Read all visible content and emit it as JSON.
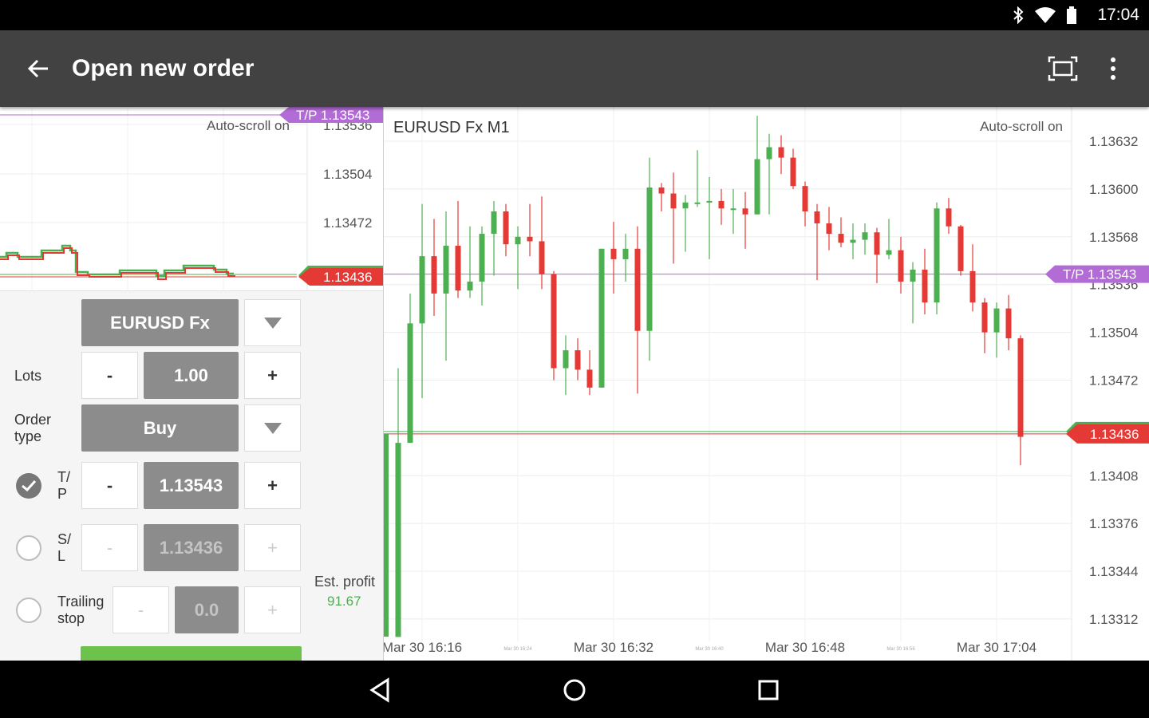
{
  "status": {
    "time": "17:04",
    "icons": [
      "bluetooth-icon",
      "wifi-icon",
      "battery-icon"
    ]
  },
  "appbar": {
    "title": "Open new order",
    "icons": [
      "back-arrow-icon",
      "fullscreen-icon",
      "more-vert-icon"
    ]
  },
  "mini_chart": {
    "autoscroll": "Auto-scroll on",
    "ticks": [
      "1.13536",
      "1.13504",
      "1.13472"
    ],
    "tp_label": "T/P 1.13543",
    "price_label": "1.13436"
  },
  "form": {
    "symbol": "EURUSD Fx",
    "lots_label": "Lots",
    "lots_value": "1.00",
    "minus": "-",
    "plus": "+",
    "order_type_label": "Order\ntype",
    "order_type_value": "Buy",
    "tp_label": "T/\nP",
    "tp_value": "1.13543",
    "tp_checked": true,
    "sl_label": "S/\nL",
    "sl_value": "1.13436",
    "sl_checked": false,
    "trailing_label": "Trailing\nstop",
    "trailing_value": "0.0",
    "trailing_checked": false,
    "est_profit_label": "Est. profit",
    "est_profit_value": "91.67"
  },
  "chart_data": {
    "type": "candlestick",
    "title": "EURUSD Fx M1",
    "autoscroll": "Auto-scroll on",
    "y_ticks": [
      "1.13632",
      "1.13600",
      "1.13568",
      "1.13536",
      "1.13504",
      "1.13472",
      "1.13436",
      "1.13408",
      "1.13376",
      "1.13344",
      "1.13312"
    ],
    "ylim": [
      1.13297,
      1.13655
    ],
    "x_labels": [
      "Mar 30 16:16",
      "Mar 30 16:32",
      "Mar 30 16:48",
      "Mar 30 17:04"
    ],
    "x_minor_labels": [
      "Mar 30 16:24",
      "Mar 30 16:40",
      "Mar 30 16:56"
    ],
    "tp_label": "T/P 1.13543",
    "tp_value": 1.13543,
    "price_label": "1.13436",
    "price_value": 1.13436,
    "colors": {
      "up": "#4caf50",
      "down": "#e53935",
      "tp": "#b36bd6",
      "grid": "#ececec"
    },
    "candles": [
      {
        "o": 1.133,
        "h": 1.1348,
        "l": 1.133,
        "c": 1.1343
      },
      {
        "o": 1.1343,
        "h": 1.1353,
        "l": 1.1343,
        "c": 1.1351
      },
      {
        "o": 1.1351,
        "h": 1.1359,
        "l": 1.1346,
        "c": 1.13555
      },
      {
        "o": 1.13555,
        "h": 1.1358,
        "l": 1.13515,
        "c": 1.1353
      },
      {
        "o": 1.1353,
        "h": 1.13585,
        "l": 1.13485,
        "c": 1.13562
      },
      {
        "o": 1.13562,
        "h": 1.13592,
        "l": 1.13527,
        "c": 1.13532
      },
      {
        "o": 1.13532,
        "h": 1.13575,
        "l": 1.13527,
        "c": 1.13538
      },
      {
        "o": 1.13538,
        "h": 1.13575,
        "l": 1.13522,
        "c": 1.1357
      },
      {
        "o": 1.1357,
        "h": 1.13592,
        "l": 1.13542,
        "c": 1.13585
      },
      {
        "o": 1.13585,
        "h": 1.1359,
        "l": 1.13555,
        "c": 1.13563
      },
      {
        "o": 1.13563,
        "h": 1.13575,
        "l": 1.13533,
        "c": 1.13568
      },
      {
        "o": 1.13568,
        "h": 1.1359,
        "l": 1.13555,
        "c": 1.13565
      },
      {
        "o": 1.13565,
        "h": 1.13595,
        "l": 1.13533,
        "c": 1.13543
      },
      {
        "o": 1.13543,
        "h": 1.13545,
        "l": 1.13472,
        "c": 1.1348
      },
      {
        "o": 1.1348,
        "h": 1.13502,
        "l": 1.13462,
        "c": 1.13492
      },
      {
        "o": 1.13492,
        "h": 1.135,
        "l": 1.13472,
        "c": 1.13479
      },
      {
        "o": 1.13479,
        "h": 1.13492,
        "l": 1.13462,
        "c": 1.13467
      },
      {
        "o": 1.13467,
        "h": 1.1356,
        "l": 1.13467,
        "c": 1.1356
      },
      {
        "o": 1.1356,
        "h": 1.13578,
        "l": 1.1353,
        "c": 1.13553
      },
      {
        "o": 1.13553,
        "h": 1.1357,
        "l": 1.13538,
        "c": 1.1356
      },
      {
        "o": 1.1356,
        "h": 1.13575,
        "l": 1.13463,
        "c": 1.13505
      },
      {
        "o": 1.13505,
        "h": 1.13621,
        "l": 1.13485,
        "c": 1.13601
      },
      {
        "o": 1.13601,
        "h": 1.13604,
        "l": 1.13585,
        "c": 1.13597
      },
      {
        "o": 1.13597,
        "h": 1.13611,
        "l": 1.1355,
        "c": 1.13587
      },
      {
        "o": 1.13587,
        "h": 1.13596,
        "l": 1.13558,
        "c": 1.13591
      },
      {
        "o": 1.13591,
        "h": 1.13626,
        "l": 1.13588,
        "c": 1.13591
      },
      {
        "o": 1.13591,
        "h": 1.13608,
        "l": 1.13553,
        "c": 1.13592
      },
      {
        "o": 1.13592,
        "h": 1.136,
        "l": 1.13576,
        "c": 1.13587
      },
      {
        "o": 1.13587,
        "h": 1.136,
        "l": 1.1357,
        "c": 1.13587
      },
      {
        "o": 1.13587,
        "h": 1.13598,
        "l": 1.1356,
        "c": 1.13583
      },
      {
        "o": 1.13583,
        "h": 1.13649,
        "l": 1.13583,
        "c": 1.1362
      },
      {
        "o": 1.1362,
        "h": 1.13637,
        "l": 1.13583,
        "c": 1.13628
      },
      {
        "o": 1.13628,
        "h": 1.13636,
        "l": 1.1361,
        "c": 1.13621
      },
      {
        "o": 1.13621,
        "h": 1.13627,
        "l": 1.136,
        "c": 1.13602
      },
      {
        "o": 1.13602,
        "h": 1.13605,
        "l": 1.13575,
        "c": 1.13585
      },
      {
        "o": 1.13585,
        "h": 1.1359,
        "l": 1.13539,
        "c": 1.13577
      },
      {
        "o": 1.13577,
        "h": 1.13588,
        "l": 1.13559,
        "c": 1.1357
      },
      {
        "o": 1.1357,
        "h": 1.13581,
        "l": 1.13561,
        "c": 1.13564
      },
      {
        "o": 1.13564,
        "h": 1.13577,
        "l": 1.13553,
        "c": 1.13566
      },
      {
        "o": 1.13566,
        "h": 1.13577,
        "l": 1.13556,
        "c": 1.13571
      },
      {
        "o": 1.13571,
        "h": 1.13574,
        "l": 1.13537,
        "c": 1.13556
      },
      {
        "o": 1.13556,
        "h": 1.1358,
        "l": 1.13553,
        "c": 1.13559
      },
      {
        "o": 1.13559,
        "h": 1.13568,
        "l": 1.1353,
        "c": 1.13538
      },
      {
        "o": 1.13538,
        "h": 1.13551,
        "l": 1.1351,
        "c": 1.13546
      },
      {
        "o": 1.13546,
        "h": 1.1356,
        "l": 1.13516,
        "c": 1.13524
      },
      {
        "o": 1.13524,
        "h": 1.13591,
        "l": 1.13516,
        "c": 1.13587
      },
      {
        "o": 1.13587,
        "h": 1.13594,
        "l": 1.1357,
        "c": 1.13575
      },
      {
        "o": 1.13575,
        "h": 1.13576,
        "l": 1.13542,
        "c": 1.13545
      },
      {
        "o": 1.13545,
        "h": 1.13563,
        "l": 1.13518,
        "c": 1.13524
      },
      {
        "o": 1.13524,
        "h": 1.13527,
        "l": 1.1349,
        "c": 1.13504
      },
      {
        "o": 1.13504,
        "h": 1.13524,
        "l": 1.13487,
        "c": 1.1352
      },
      {
        "o": 1.1352,
        "h": 1.13529,
        "l": 1.13492,
        "c": 1.135
      },
      {
        "o": 1.135,
        "h": 1.13502,
        "l": 1.13415,
        "c": 1.13434
      }
    ]
  }
}
